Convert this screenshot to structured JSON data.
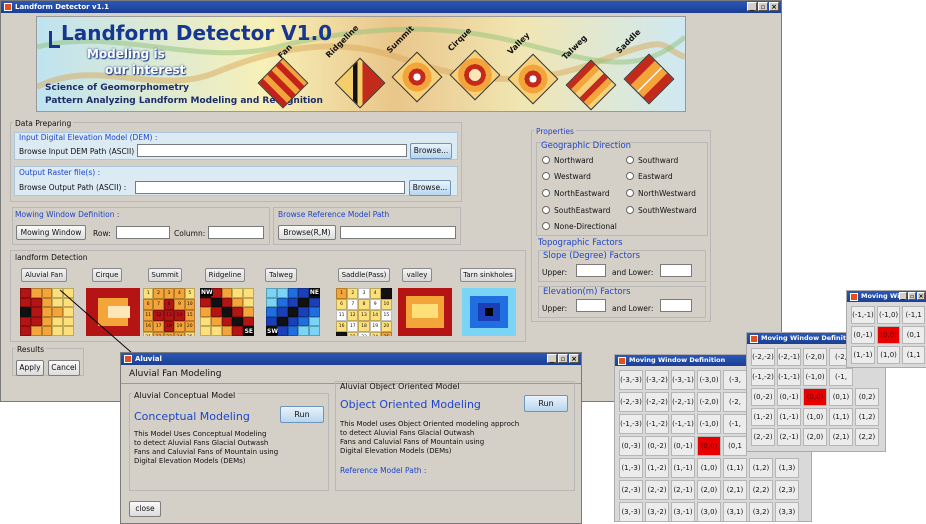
{
  "main": {
    "title": "Landform Detector v1.1",
    "win_buttons": [
      "_",
      "▫",
      "×"
    ]
  },
  "banner": {
    "title": "Landform Detector V1.0",
    "slogan1": "Modeling is",
    "slogan2": "our interest",
    "sub1": "Science of Geomorphometry",
    "sub2": "Pattern Analyzing Landform Modeling and Recognition",
    "landforms": [
      "Fan",
      "Ridgeline",
      "Summit",
      "Cirque",
      "Valley",
      "Talweg",
      "Saddle"
    ]
  },
  "data_preparing": {
    "legend": "Data Preparing",
    "dem_title": "Input Digital Elevation Model (DEM) :",
    "dem_label": "Browse Input DEM Path (ASCII) :",
    "dem_value": "",
    "browse1": "Browse...",
    "out_title": "Output Raster file(s) :",
    "out_label": "Browse Output Path (ASCII) :",
    "out_value": "",
    "browse2": "Browse..."
  },
  "moving": {
    "title": "Mowing Window Definition :",
    "button": "Mowing Window",
    "row_label": "Row:",
    "col_label": "Column:",
    "row_value": "",
    "col_value": ""
  },
  "reference": {
    "title": "Browse Reference Model Path",
    "button": "Browse(R,M)",
    "value": ""
  },
  "detection": {
    "legend": "landform Detection",
    "buttons": [
      "Aluvial Fan",
      "Cirque",
      "Summit",
      "Ridgeline",
      "Talweg",
      "Saddle(Pass)",
      "valley",
      "Tarn sinkholes"
    ]
  },
  "results": {
    "legend": "Results",
    "apply": "Apply",
    "cancel": "Cancel"
  },
  "properties": {
    "legend": "Properties",
    "geo_title": "Geographic Direction",
    "directions": [
      "Northward",
      "Southward",
      "Westward",
      "Eastward",
      "NorthEastward",
      "NorthWestward",
      "SouthEastward",
      "SouthWestward",
      "None-Directional"
    ],
    "topo_title": "Topographic Factors",
    "slope_title": "Slope (Degree) Factors",
    "elev_title": "Elevation(m) Factors",
    "upper": "Upper:",
    "lower": "and Lower:"
  },
  "aluvial": {
    "title": "Aluvial",
    "heading": "Aluvial Fan Modeling",
    "conc_legend": "Aluvial Conceptual Model",
    "conc_title": "Conceptual Modeling",
    "conc_run": "Run",
    "conc_desc": [
      "This Model Uses Conceptual Modeling",
      "to detect Aluvial Fans Glacial Outwash",
      "Fans and Caluvial Fans of Mountain using",
      "Digital Elevation Models (DEMs)"
    ],
    "oo_legend": "Aluvial Object Oriented Model",
    "oo_title": "Object Oriented Modeling",
    "oo_run": "Run",
    "oo_desc": [
      "This Model uses Object Oriented modeling approch",
      "to detect Aluvial Fans Glacial Outwash",
      "Fans and Caluvial Fans of Mountain using",
      "Digital Elevation Models (DEMs)"
    ],
    "ref_label": "Reference Model Path :",
    "close": "close"
  },
  "mw_large": {
    "title": "Moving Window Definition",
    "rows": [
      [
        "(-3,-3)",
        "(-3,-2)",
        "(-3,-1)",
        "(-3,0)",
        "(-3,"
      ],
      [
        "(-2,-3)",
        "(-2,-2)",
        "(-2,-1)",
        "(-2,0)",
        "(-2,"
      ],
      [
        "(-1,-3)",
        "(-1,-2)",
        "(-1,-1)",
        "(-1,0)",
        "(-1,"
      ],
      [
        "(0,-3)",
        "(0,-2)",
        "(0,-1)",
        "(0,0)",
        "(0,1"
      ],
      [
        "(1,-3)",
        "(1,-2)",
        "(1,-1)",
        "(1,0)",
        "(1,1)",
        "(1,2)",
        "(1,3)"
      ],
      [
        "(2,-3)",
        "(2,-2)",
        "(2,-1)",
        "(2,0)",
        "(2,1)",
        "(2,2)",
        "(2,3)"
      ],
      [
        "(3,-3)",
        "(3,-2)",
        "(3,-1)",
        "(3,0)",
        "(3,1)",
        "(3,2)",
        "(3,3)"
      ]
    ]
  },
  "mw_medium": {
    "title": "Moving Window Definitio",
    "rows": [
      [
        "(-2,-2)",
        "(-2,-1)",
        "(-2,0)",
        "(-2,"
      ],
      [
        "(-1,-2)",
        "(-1,-1)",
        "(-1,0)",
        "(-1,"
      ],
      [
        "(0,-2)",
        "(0,-1)",
        "(0,0)",
        "(0,1)",
        "(0,2)"
      ],
      [
        "(1,-2)",
        "(1,-1)",
        "(1,0)",
        "(1,1)",
        "(1,2)"
      ],
      [
        "(2,-2)",
        "(2,-1)",
        "(2,0)",
        "(2,1)",
        "(2,2)"
      ]
    ]
  },
  "mw_small": {
    "title": "Moving Wi",
    "rows": [
      [
        "(-1,-1)",
        "(-1,0)",
        "(-1,1"
      ],
      [
        "(0,-1)",
        "(0,0)",
        "(0,1"
      ],
      [
        "(1,-1)",
        "(1,0)",
        "(1,1"
      ]
    ]
  },
  "summit_numbers": [
    "1",
    "2",
    "3",
    "4",
    "5",
    "6",
    "7",
    "8",
    "9",
    "10",
    "11",
    "12",
    "13",
    "14",
    "15",
    "16",
    "17",
    "18",
    "19",
    "20",
    "21",
    "22",
    "23",
    "24",
    "25"
  ],
  "saddle_numbers": [
    "1",
    "2",
    "3",
    "4",
    "5",
    "6",
    "7",
    "8",
    "9",
    "10",
    "11",
    "12",
    "13",
    "14",
    "15",
    "16",
    "17",
    "18",
    "19",
    "20",
    "21",
    "22",
    "23",
    "24",
    "25"
  ],
  "ridgeline_labels": {
    "nw": "NW",
    "se": "SE"
  },
  "talweg_labels": {
    "ne": "NE",
    "sw": "SW"
  }
}
